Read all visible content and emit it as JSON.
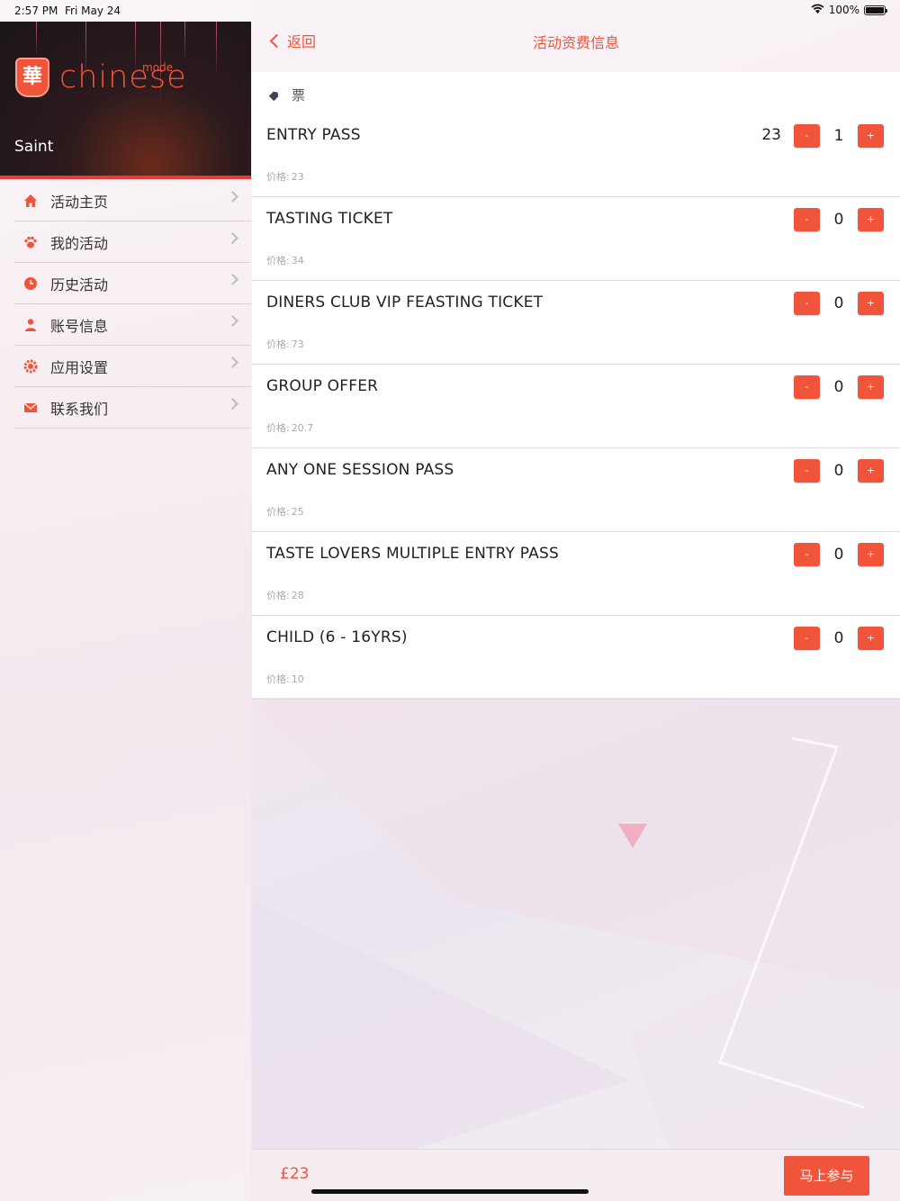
{
  "status_bar": {
    "time": "2:57 PM",
    "date": "Fri May 24",
    "battery": "100%",
    "battery_level": 1.0
  },
  "sidebar": {
    "logo_badge": "華",
    "logo_text": "chinese",
    "logo_sub": "mode",
    "username": "Saint",
    "items": [
      {
        "label": "活动主页",
        "icon": "home-icon"
      },
      {
        "label": "我的活动",
        "icon": "paw-icon"
      },
      {
        "label": "历史活动",
        "icon": "clock-icon"
      },
      {
        "label": "账号信息",
        "icon": "person-icon"
      },
      {
        "label": "应用设置",
        "icon": "gear-icon"
      },
      {
        "label": "联系我们",
        "icon": "mail-icon"
      }
    ]
  },
  "nav": {
    "back_label": "返回",
    "title": "活动资费信息"
  },
  "tickets": {
    "section_label": "票",
    "price_prefix": "价格:",
    "items": [
      {
        "name": "ENTRY PASS",
        "price": "23",
        "quantity": "1",
        "row_total": "23"
      },
      {
        "name": "TASTING TICKET",
        "price": "34",
        "quantity": "0",
        "row_total": ""
      },
      {
        "name": "DINERS CLUB VIP FEASTING TICKET",
        "price": "73",
        "quantity": "0",
        "row_total": ""
      },
      {
        "name": "GROUP OFFER",
        "price": "20.7",
        "quantity": "0",
        "row_total": ""
      },
      {
        "name": "ANY ONE SESSION PASS",
        "price": "25",
        "quantity": "0",
        "row_total": ""
      },
      {
        "name": "TASTE LOVERS MULTIPLE ENTRY PASS",
        "price": "28",
        "quantity": "0",
        "row_total": ""
      },
      {
        "name": "CHILD (6 - 16YRS)",
        "price": "10",
        "quantity": "0",
        "row_total": ""
      }
    ],
    "minus_label": "-",
    "plus_label": "+"
  },
  "footer": {
    "total": "£23",
    "join_label": "马上参与"
  },
  "colors": {
    "accent": "#f0553b",
    "banner_dark": "#1a1519"
  }
}
